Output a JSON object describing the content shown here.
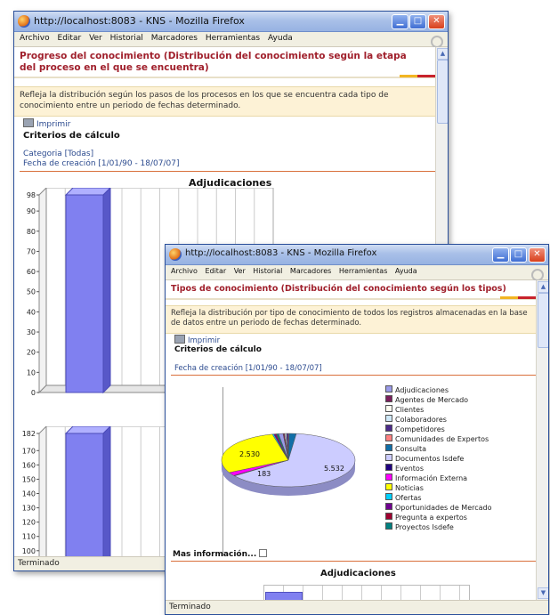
{
  "window1": {
    "title": "http://localhost:8083 - KNS - Mozilla Firefox",
    "menu": [
      "Archivo",
      "Editar",
      "Ver",
      "Historial",
      "Marcadores",
      "Herramientas",
      "Ayuda"
    ],
    "heading": "Progreso del conocimiento (Distribución del conocimiento según la etapa del proceso en el que se encuentra)",
    "description": "Refleja la distribución según los pasos de los procesos en los que se encuentra cada tipo de conocimiento entre un periodo de fechas determinado.",
    "print_label": "Imprimir",
    "criteria_title": "Criterios de cálculo",
    "category": "Categoria [Todas]",
    "date_range": "Fecha de creación  [1/01/90 - 18/07/07]",
    "status": "Terminado"
  },
  "window2": {
    "title": "http://localhost:8083 - KNS - Mozilla Firefox",
    "menu": [
      "Archivo",
      "Editar",
      "Ver",
      "Historial",
      "Marcadores",
      "Herramientas",
      "Ayuda"
    ],
    "heading": "Tipos de conocimiento (Distribución del conocimiento según los tipos)",
    "description": "Refleja la distribución por tipo de conocimiento de todos los registros almacenadas en la base de datos entre un periodo de fechas determinado.",
    "print_label": "Imprimir",
    "criteria_title": "Criterios de cálculo",
    "date_range": "Fecha de creación  [1/01/90 - 18/07/07]",
    "more_info": "Mas información...",
    "chart2_title": "Adjudicaciones",
    "status": "Terminado"
  },
  "chart_data": [
    {
      "type": "bar",
      "title": "Adjudicaciones",
      "categories": [
        ""
      ],
      "values": [
        98
      ],
      "ylim": [
        0,
        98
      ],
      "yticks": [
        0,
        10,
        20,
        30,
        40,
        50,
        60,
        70,
        80,
        90,
        98
      ],
      "data_labels": [
        "98"
      ],
      "grid": true,
      "color": "#8080f0"
    },
    {
      "type": "bar",
      "title": "",
      "categories": [
        ""
      ],
      "values": [
        182
      ],
      "ylim": [
        70,
        182
      ],
      "yticks": [
        70,
        80,
        90,
        100,
        110,
        120,
        130,
        140,
        150,
        160,
        170,
        182
      ],
      "data_labels": [
        "182"
      ],
      "grid": true,
      "color": "#8080f0"
    },
    {
      "type": "pie",
      "title": "",
      "labels": [
        "Adjudicaciones",
        "Agentes de Mercado",
        "Clientes",
        "Colaboradores",
        "Competidores",
        "Comunidades de Expertos",
        "Consulta",
        "Documentos Isdefe",
        "Eventos",
        "Información Externa",
        "Noticias",
        "Ofertas",
        "Oportunidades de Mercado",
        "Pregunta a expertos",
        "Proyectos Isdefe"
      ],
      "values": [
        98,
        30,
        20,
        25,
        40,
        15,
        150,
        5532,
        25,
        183,
        2530,
        30,
        40,
        20,
        40
      ],
      "data_labels": [
        {
          "label": "Documentos Isdefe",
          "text": "5.532"
        },
        {
          "label": "Noticias",
          "text": "2.530"
        },
        {
          "label": "Información Externa",
          "text": "183"
        }
      ],
      "colors": [
        "#9a9ae8",
        "#7a1f5c",
        "#fffff0",
        "#cfe8f8",
        "#4b2a8a",
        "#ff8080",
        "#106ea8",
        "#ccccff",
        "#200080",
        "#ff00ff",
        "#ffff00",
        "#00d0ff",
        "#700090",
        "#a00030",
        "#008080"
      ],
      "legend_position": "right"
    }
  ]
}
